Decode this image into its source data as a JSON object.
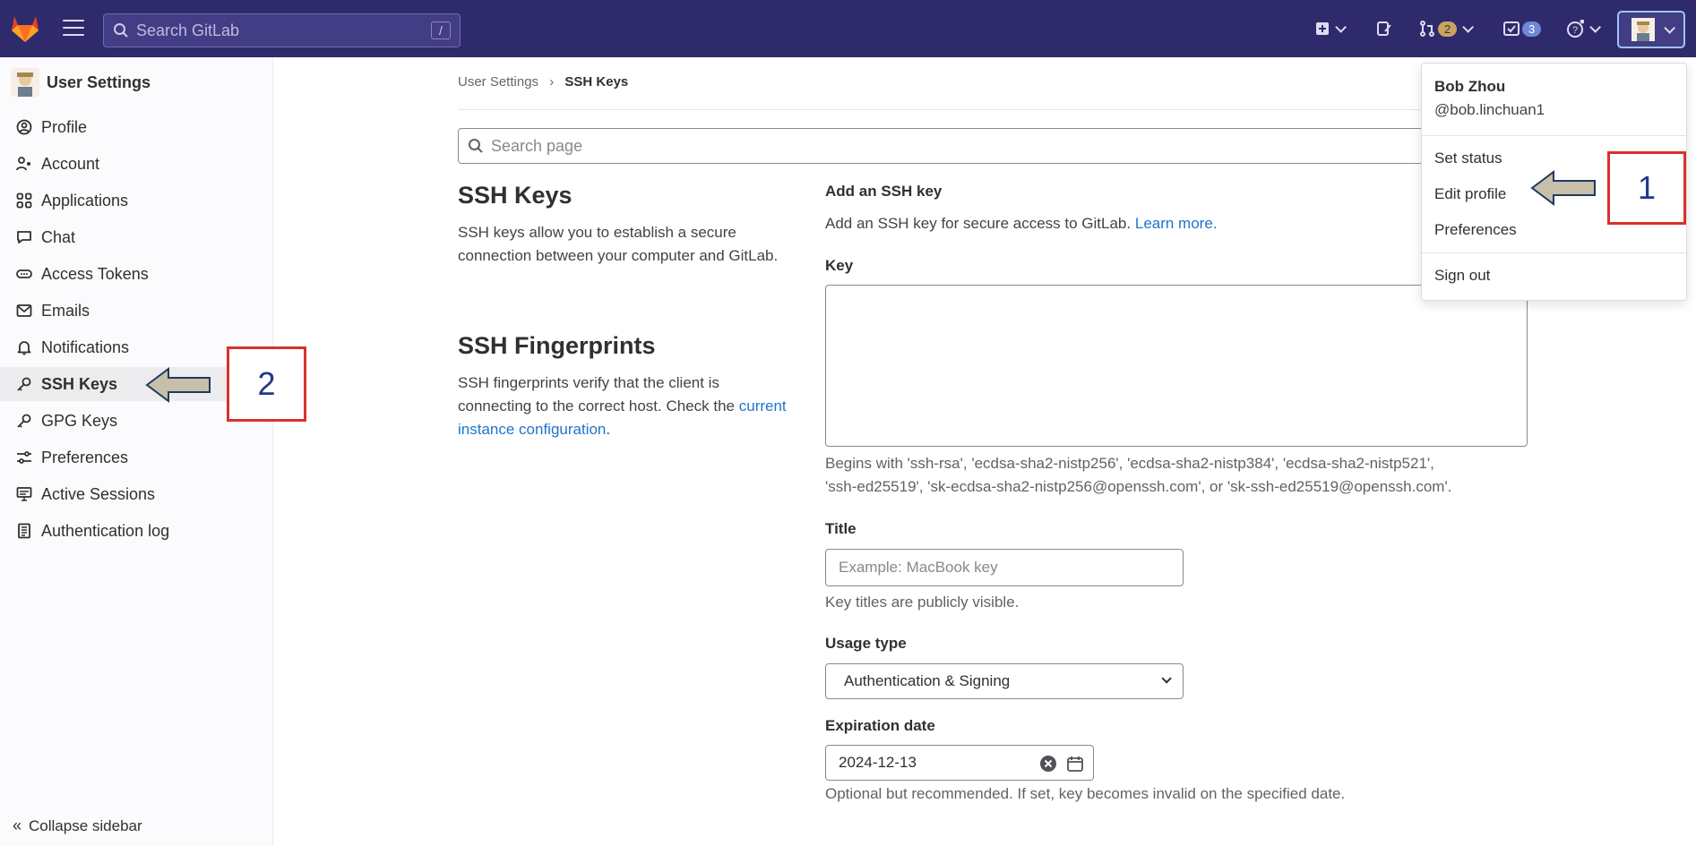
{
  "topbar": {
    "search_placeholder": "Search GitLab",
    "search_shortcut": "/",
    "merge_requests_count": "2",
    "todos_count": "3"
  },
  "sidebar": {
    "title": "User Settings",
    "items": [
      {
        "label": "Profile",
        "icon": "user-icon"
      },
      {
        "label": "Account",
        "icon": "account-icon"
      },
      {
        "label": "Applications",
        "icon": "applications-icon"
      },
      {
        "label": "Chat",
        "icon": "chat-icon"
      },
      {
        "label": "Access Tokens",
        "icon": "token-icon"
      },
      {
        "label": "Emails",
        "icon": "mail-icon"
      },
      {
        "label": "Notifications",
        "icon": "bell-icon"
      },
      {
        "label": "SSH Keys",
        "icon": "key-icon"
      },
      {
        "label": "GPG Keys",
        "icon": "key-icon"
      },
      {
        "label": "Preferences",
        "icon": "preferences-icon"
      },
      {
        "label": "Active Sessions",
        "icon": "monitor-icon"
      },
      {
        "label": "Authentication log",
        "icon": "log-icon"
      }
    ],
    "collapse_label": "Collapse sidebar"
  },
  "breadcrumb": {
    "parent": "User Settings",
    "separator": "›",
    "current": "SSH Keys"
  },
  "page_search_placeholder": "Search page",
  "ssh_keys_section": {
    "title": "SSH Keys",
    "description": "SSH keys allow you to establish a secure connection between your computer and GitLab."
  },
  "fingerprints_section": {
    "title": "SSH Fingerprints",
    "description": "SSH fingerprints verify that the client is connecting to the correct host. Check the",
    "link": "current instance configuration",
    "suffix": "."
  },
  "form": {
    "heading": "Add an SSH key",
    "subheading": "Add an SSH key for secure access to GitLab.",
    "learn_more": "Learn more.",
    "key_label": "Key",
    "key_help_1": "Begins with 'ssh-rsa', 'ecdsa-sha2-nistp256', 'ecdsa-sha2-nistp384', 'ecdsa-sha2-nistp521',",
    "key_help_2": "'ssh-ed25519', 'sk-ecdsa-sha2-nistp256@openssh.com', or 'sk-ssh-ed25519@openssh.com'.",
    "title_label": "Title",
    "title_placeholder": "Example: MacBook key",
    "title_help": "Key titles are publicly visible.",
    "usage_label": "Usage type",
    "usage_value": "Authentication & Signing",
    "expiration_label": "Expiration date",
    "expiration_value": "2024-12-13",
    "expiration_help": "Optional but recommended. If set, key becomes invalid on the specified date."
  },
  "user_menu": {
    "name": "Bob Zhou",
    "username": "@bob.linchuan1",
    "set_status": "Set status",
    "edit_profile": "Edit profile",
    "preferences": "Preferences",
    "sign_out": "Sign out"
  },
  "annotations": {
    "step1": "1",
    "step2": "2"
  },
  "colors": {
    "topbar": "#2f2a6b",
    "link": "#1f75cb",
    "annotation_border": "#d9322b"
  }
}
